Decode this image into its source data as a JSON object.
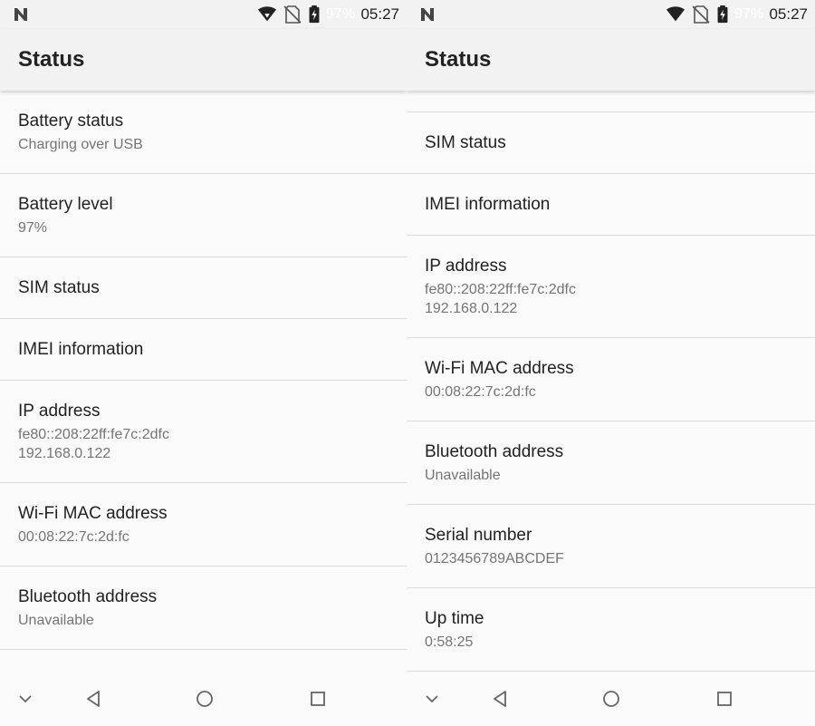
{
  "left": {
    "status_bar": {
      "battery_pct": "97%",
      "time": "05:27"
    },
    "app_bar": {
      "title": "Status"
    },
    "items": [
      {
        "title": "Battery status",
        "sub": [
          "Charging over USB"
        ]
      },
      {
        "title": "Battery level",
        "sub": [
          "97%"
        ]
      },
      {
        "title": "SIM status",
        "sub": []
      },
      {
        "title": "IMEI information",
        "sub": []
      },
      {
        "title": "IP address",
        "sub": [
          "fe80::208:22ff:fe7c:2dfc",
          "192.168.0.122"
        ]
      },
      {
        "title": "Wi-Fi MAC address",
        "sub": [
          "00:08:22:7c:2d:fc"
        ]
      },
      {
        "title": "Bluetooth address",
        "sub": [
          "Unavailable"
        ]
      }
    ]
  },
  "right": {
    "status_bar": {
      "battery_pct": "97%",
      "time": "05:27"
    },
    "app_bar": {
      "title": "Status"
    },
    "items": [
      {
        "title": "SIM status",
        "sub": []
      },
      {
        "title": "IMEI information",
        "sub": []
      },
      {
        "title": "IP address",
        "sub": [
          "fe80::208:22ff:fe7c:2dfc",
          "192.168.0.122"
        ]
      },
      {
        "title": "Wi-Fi MAC address",
        "sub": [
          "00:08:22:7c:2d:fc"
        ]
      },
      {
        "title": "Bluetooth address",
        "sub": [
          "Unavailable"
        ]
      },
      {
        "title": "Serial number",
        "sub": [
          "0123456789ABCDEF"
        ]
      },
      {
        "title": "Up time",
        "sub": [
          "0:58:25"
        ]
      }
    ]
  },
  "icons": {
    "status_logo": "n-logo-icon",
    "wifi": "wifi-icon",
    "no_sim": "no-sim-icon",
    "battery": "battery-charging-icon",
    "nav_hide": "chevron-down-icon",
    "nav_back": "back-triangle-icon",
    "nav_home": "home-circle-icon",
    "nav_recents": "recents-square-icon"
  },
  "colors": {
    "background": "#fafafa",
    "bar": "#f2f2f2",
    "divider": "#dcdcdc",
    "title_text": "#222222",
    "sub_text": "#757575"
  }
}
